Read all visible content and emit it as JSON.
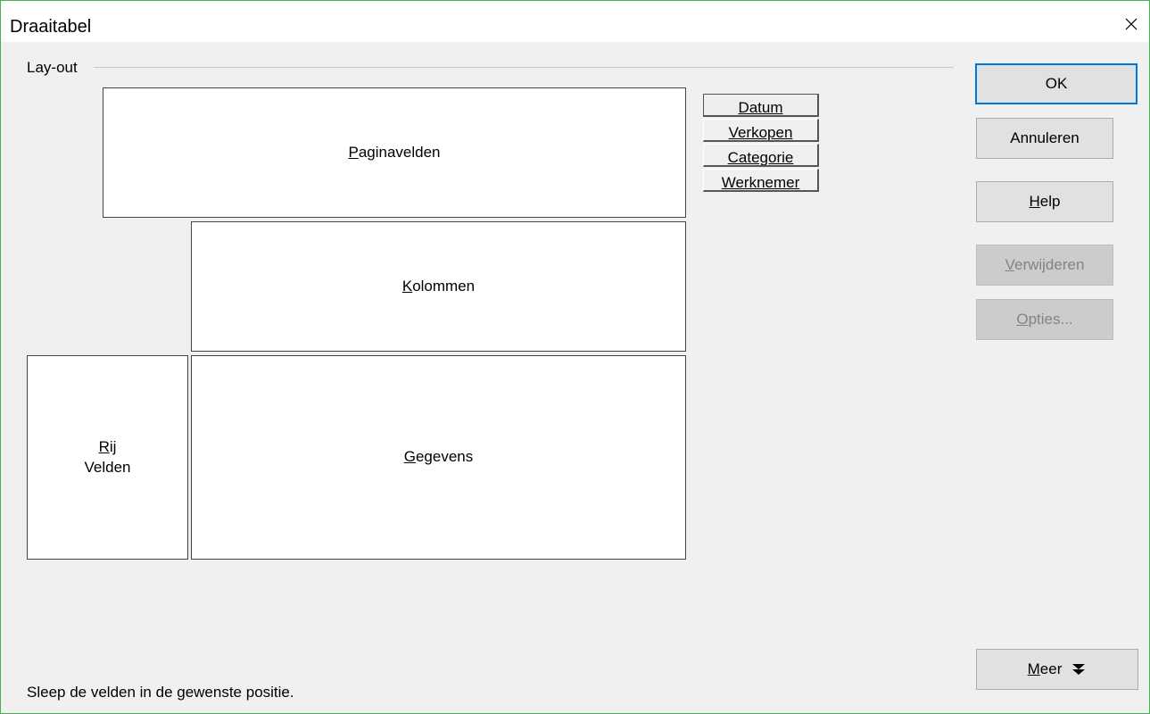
{
  "window": {
    "title": "Draaitabel",
    "close_glyph": "✕"
  },
  "layout": {
    "group_label": "Lay-out",
    "zones": {
      "page_fields": {
        "accel": "P",
        "rest": "aginavelden"
      },
      "columns": {
        "accel": "K",
        "rest": "olommen"
      },
      "row_line1_accel": "R",
      "row_line1_rest": "ij",
      "row_line2": "Velden",
      "data": {
        "accel": "G",
        "rest": "egevens"
      }
    },
    "available_fields": [
      "Datum",
      "Verkopen",
      "Categorie",
      "Werknemer"
    ]
  },
  "buttons": {
    "ok": "OK",
    "cancel": "Annuleren",
    "help_accel": "H",
    "help_rest": "elp",
    "remove_accel": "V",
    "remove_rest": "erwijderen",
    "options_accel": "O",
    "options_rest": "pties...",
    "more_accel": "M",
    "more_rest": "eer",
    "more_icon": "⯯"
  },
  "status_text": "Sleep de velden in de gewenste positie.",
  "colors": {
    "window_border": "#4caf50",
    "primary_button_border": "#0078d7",
    "disabled_text": "#838383"
  }
}
